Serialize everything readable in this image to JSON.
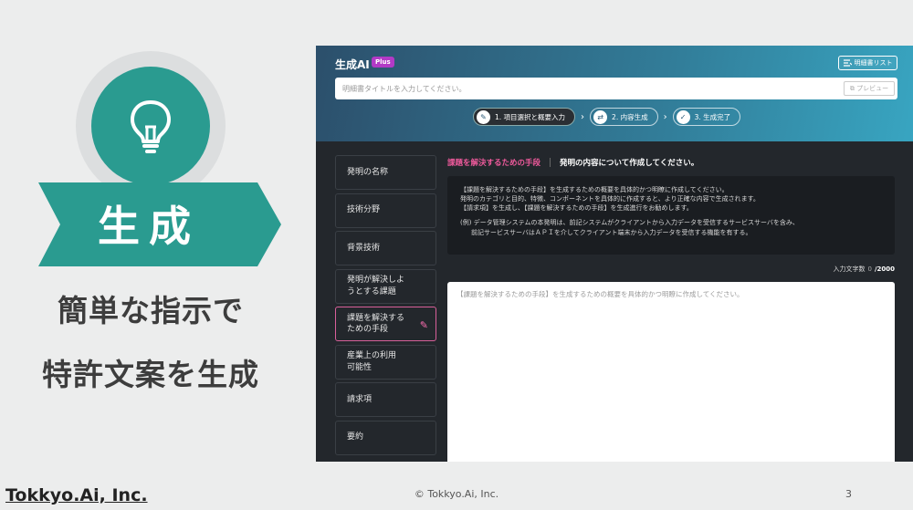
{
  "slide": {
    "section": "生成",
    "tagline_1": "簡単な指示で",
    "tagline_2": "特許文案を生成",
    "footer_brand": "Tokkyo.Ai, Inc.",
    "footer_copyright": "© Tokkyo.Ai, Inc.",
    "page_number": "3"
  },
  "app": {
    "logo": "生成AI",
    "badge": "Plus",
    "list_button": "明細書リスト",
    "title_placeholder": "明細書タイトルを入力してください。",
    "preview_button": "プレビュー",
    "steps": [
      {
        "label": "1. 項目選択と概要入力"
      },
      {
        "label": "2. 内容生成"
      },
      {
        "label": "3. 生成完了"
      }
    ],
    "sidebar": [
      {
        "line1": "発明の名称",
        "line2": ""
      },
      {
        "line1": "技術分野",
        "line2": ""
      },
      {
        "line1": "背景技術",
        "line2": ""
      },
      {
        "line1": "発明が解決しよ",
        "line2": "うとする課題"
      },
      {
        "line1": "課題を解決する",
        "line2": "ための手段"
      },
      {
        "line1": "産業上の利用",
        "line2": "可能性"
      },
      {
        "line1": "請求項",
        "line2": ""
      },
      {
        "line1": "要約",
        "line2": ""
      }
    ],
    "section_label": "課題を解決するための手段",
    "section_title": "発明の内容について作成してください。",
    "guide": {
      "line1": "【課題を解決するための手段】を生成するための概要を具体的かつ明瞭に作成してください。",
      "line2": "発明のカテゴリと目的、特徴、コンポーネントを具体的に作成すると、より正確な内容で生成されます。",
      "line3": "【請求項】を生成し、【課題を解決するための手段】を生成進行をお勧めします。",
      "example1": "(例) データ管理システムの本発明は、前記システムがクライアントから入力データを受信するサービスサーバを含み、",
      "example2": "前記サービスサーバはＡＰＩを介してクライアント端末から入力データを受信する機能を有する。"
    },
    "counter_label": "入力文字数",
    "counter_value": "0",
    "counter_max": "/2000",
    "answer_placeholder": "【課題を解決するための手段】を生成するための概要を具体的かつ明瞭に作成してください。"
  },
  "colors": {
    "teal": "#2a9b90",
    "banner": "#2a9b90",
    "accent_pink": "#ef5a9c",
    "plus_badge": "#b23ac6"
  }
}
